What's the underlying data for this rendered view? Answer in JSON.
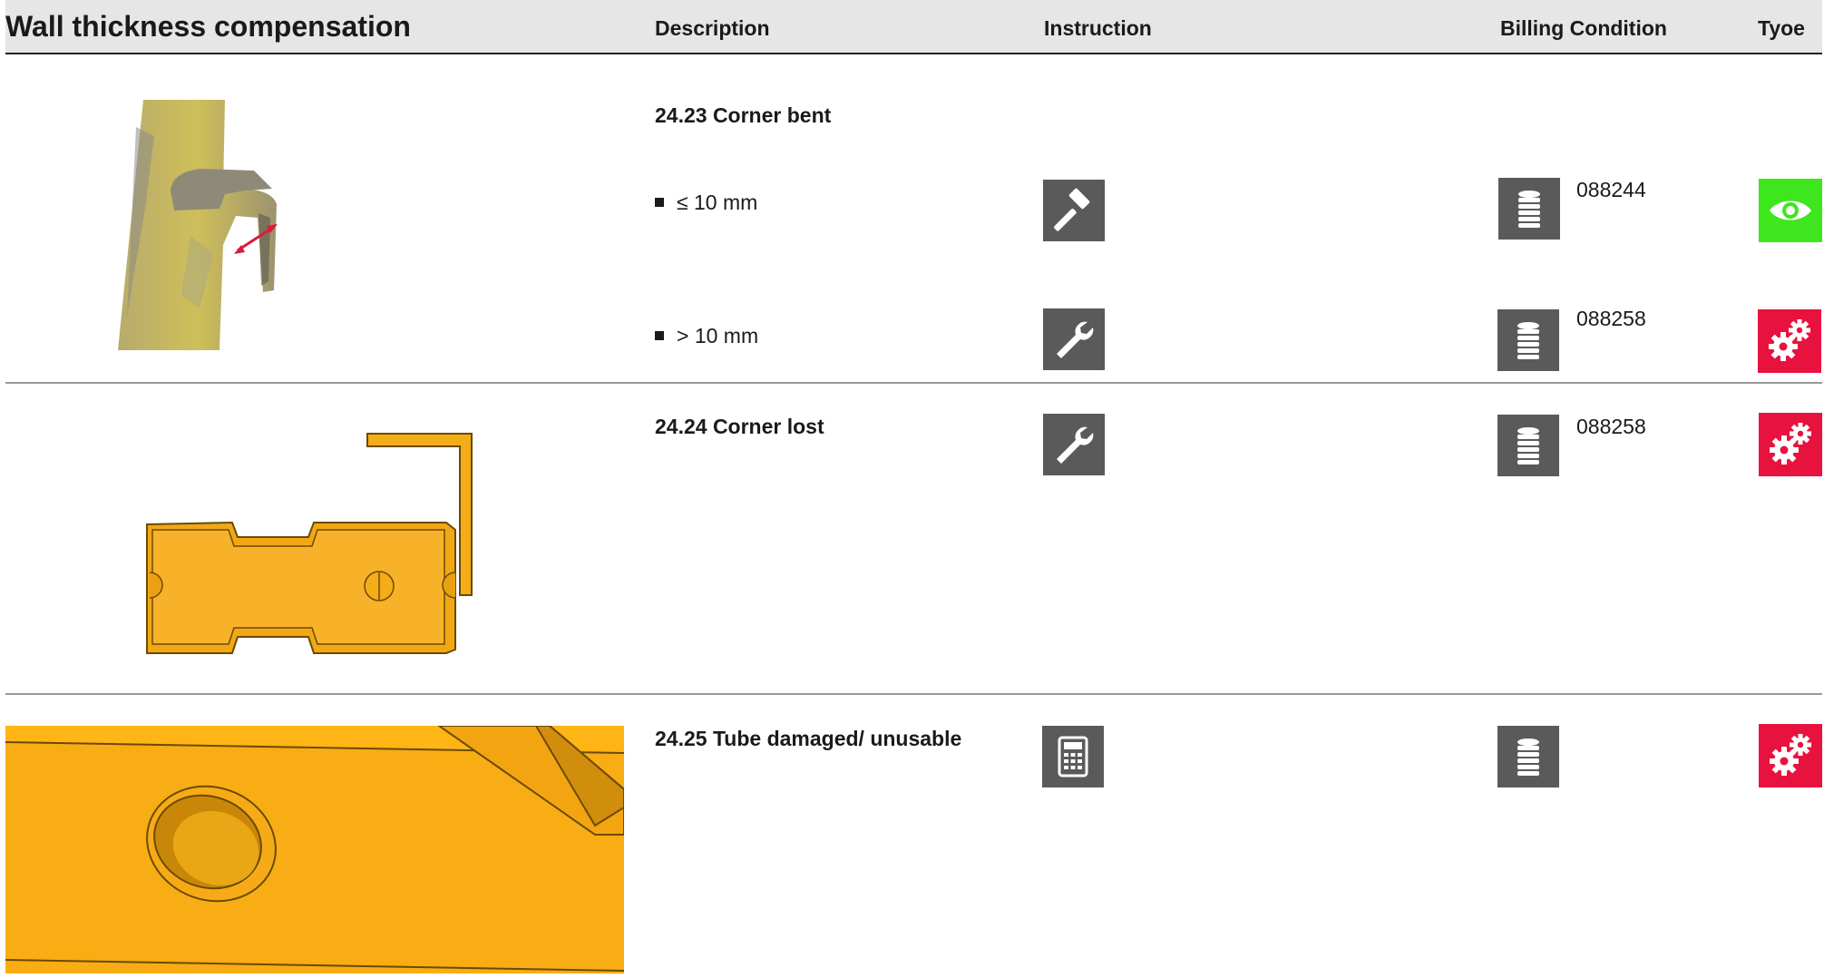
{
  "header": {
    "title": "Wall thickness compensation",
    "col_description": "Description",
    "col_instruction": "Instruction",
    "col_billing": "Billing Condition",
    "col_type": "Tyoe"
  },
  "colors": {
    "header_bg": "#e6e6e6",
    "icon_box": "#5a5a5a",
    "type_visual": "#3ee61e",
    "type_repair": "#e8123f",
    "part_yellow": "#f5ad17"
  },
  "rows": [
    {
      "title": "24.23 Corner bent",
      "image": "bent-corner-photo",
      "options": [
        {
          "bullet": "≤ 10 mm",
          "instruction_icon": "hammer-icon",
          "billing_icon": "coins-icon",
          "code": "088244",
          "type_icon": "eye-icon"
        },
        {
          "bullet": "> 10 mm",
          "instruction_icon": "wrench-icon",
          "billing_icon": "coins-icon",
          "code": "088258",
          "type_icon": "gears-icon"
        }
      ]
    },
    {
      "title": "24.24 Corner lost",
      "image": "corner-part-drawing",
      "instruction_icon": "wrench-icon",
      "billing_icon": "coins-icon",
      "code": "088258",
      "type_icon": "gears-icon"
    },
    {
      "title": "24.25 Tube damaged/ unusable",
      "image": "tube-part-drawing",
      "instruction_icon": "calculator-icon",
      "billing_icon": "coins-icon",
      "type_icon": "gears-icon"
    }
  ]
}
